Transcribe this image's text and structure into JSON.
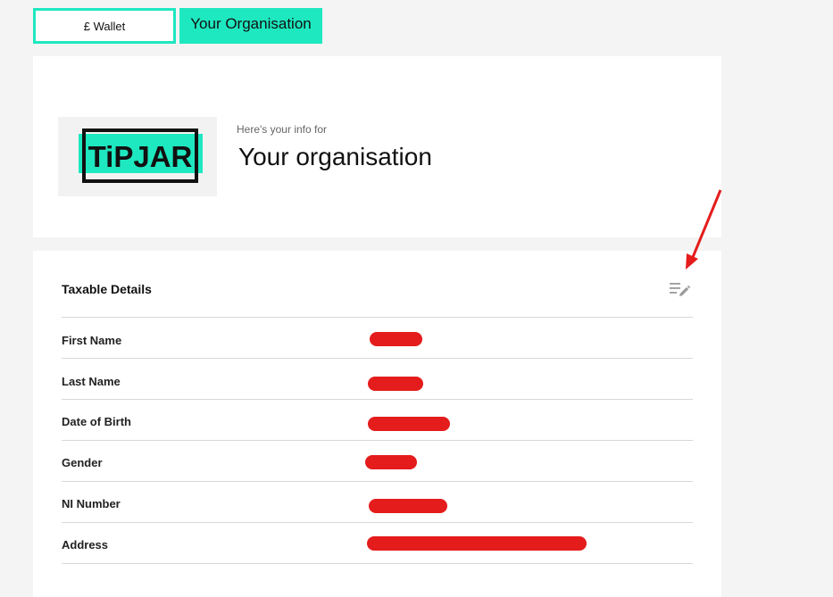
{
  "tabs": {
    "wallet_label": "£ Wallet",
    "organisation_label": "Your Organisation"
  },
  "org": {
    "logo_text": "TiPJAR",
    "intro": "Here's your info for",
    "name": "Your organisation"
  },
  "details": {
    "title": "Taxable Details",
    "rows": [
      {
        "label": "First Name"
      },
      {
        "label": "Last Name"
      },
      {
        "label": "Date of Birth"
      },
      {
        "label": "Gender"
      },
      {
        "label": "NI Number"
      },
      {
        "label": "Address"
      }
    ]
  },
  "colors": {
    "accent": "#1ee8c0",
    "redaction": "#e41c1c",
    "annotation_arrow": "#e41c1c"
  },
  "icons": {
    "edit": "edit-list-icon"
  }
}
